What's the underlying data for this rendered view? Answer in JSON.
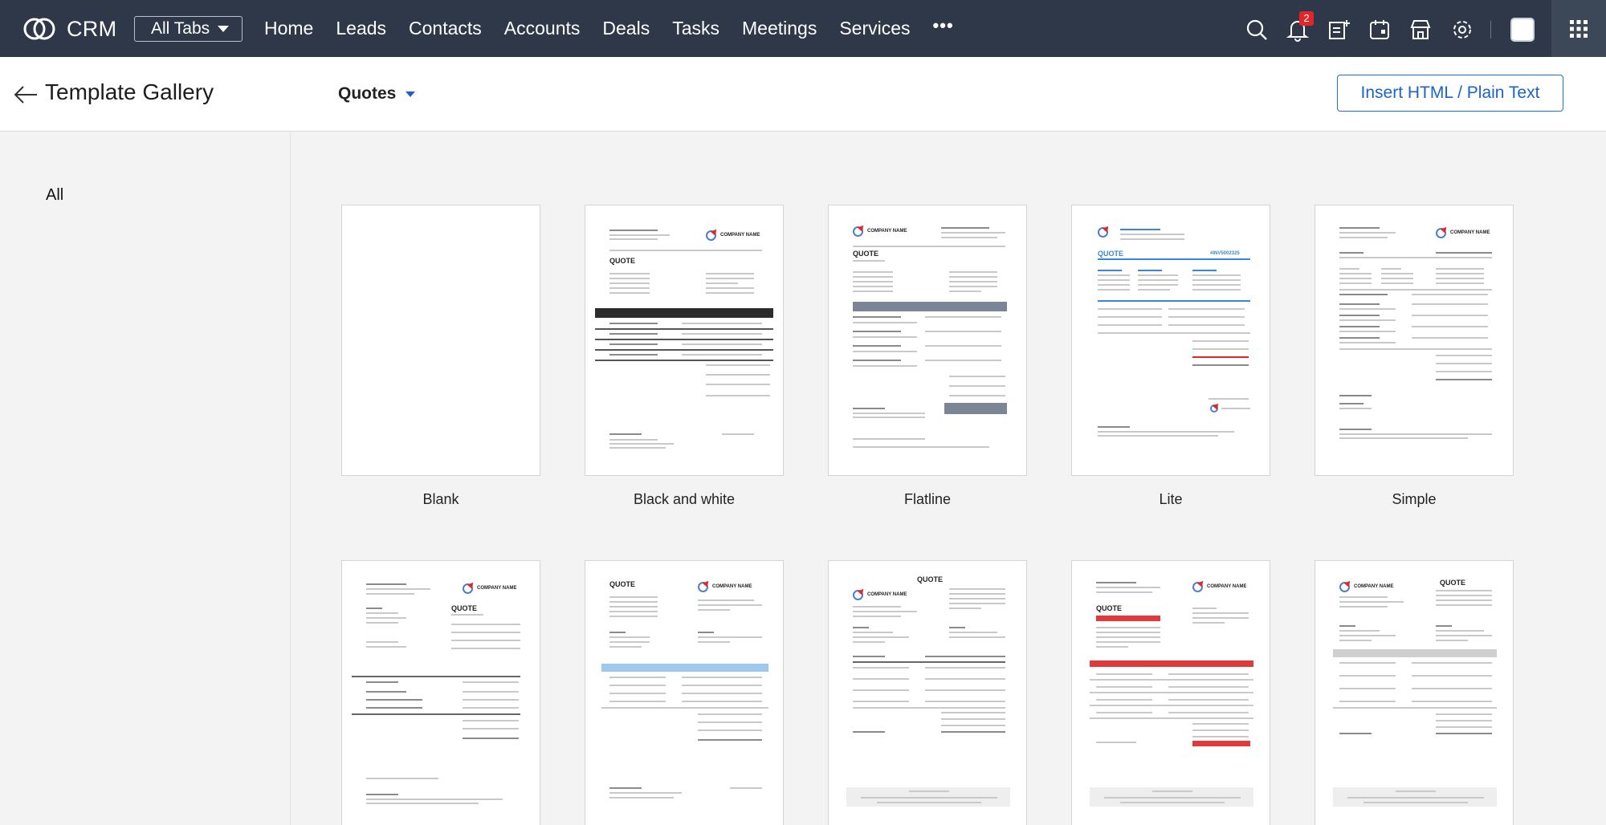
{
  "topbar": {
    "brand": "CRM",
    "all_tabs": "All Tabs",
    "nav": [
      "Home",
      "Leads",
      "Contacts",
      "Accounts",
      "Deals",
      "Tasks",
      "Meetings",
      "Services"
    ],
    "more": "•••",
    "notification_count": "2",
    "icons": [
      "search-icon",
      "bell-icon",
      "add-note-icon",
      "calendar-icon",
      "store-icon",
      "gear-icon",
      "avatar",
      "app-grid-icon"
    ]
  },
  "subheader": {
    "title": "Template Gallery",
    "module": "Quotes",
    "insert_button": "Insert HTML / Plain Text"
  },
  "sidebar": {
    "categories": [
      "All"
    ]
  },
  "templates": [
    {
      "name": "Blank"
    },
    {
      "name": "Black and white"
    },
    {
      "name": "Flatline"
    },
    {
      "name": "Lite"
    },
    {
      "name": "Simple"
    },
    {
      "name": ""
    },
    {
      "name": ""
    },
    {
      "name": ""
    },
    {
      "name": ""
    },
    {
      "name": ""
    }
  ],
  "thumbnail_text": {
    "company": "COMPANY NAME",
    "quote": "QUOTE",
    "quote_number": "#INV5002325"
  },
  "colors": {
    "topbar": "#2e3848",
    "accent_blue": "#1a63c9",
    "badge_red": "#e0262b",
    "flatline_header": "#7a8595",
    "lite_blue": "#3a86d6",
    "row2_blue": "#9ec9ef",
    "row2_red": "#e23a3a"
  }
}
